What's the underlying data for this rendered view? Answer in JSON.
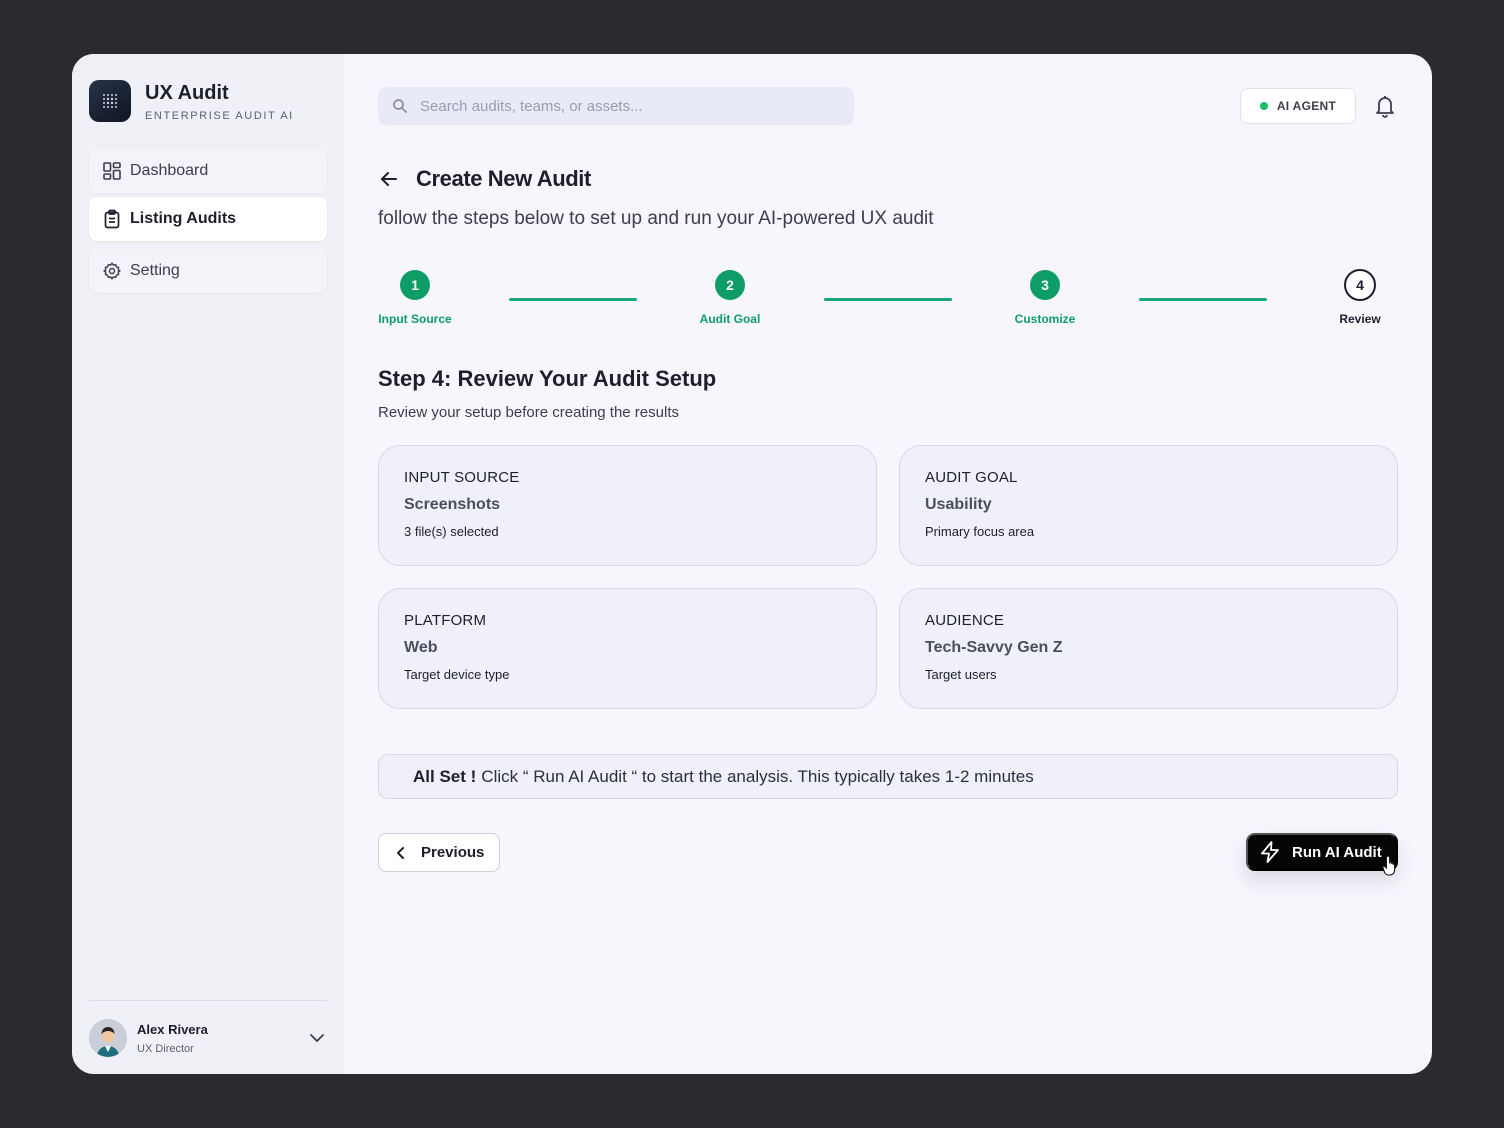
{
  "brand": {
    "name": "UX Audit",
    "subtitle": "ENTERPRISE AUDIT AI"
  },
  "sidebar": {
    "items": [
      {
        "label": "Dashboard",
        "icon": "dashboard-icon",
        "active": false
      },
      {
        "label": "Listing Audits",
        "icon": "clipboard-icon",
        "active": true
      },
      {
        "label": "Setting",
        "icon": "gear-icon",
        "active": false
      }
    ]
  },
  "user": {
    "name": "Alex Rivera",
    "role": "UX Director"
  },
  "header": {
    "search_placeholder": "Search audits, teams, or assets...",
    "agent_label": "AI AGENT"
  },
  "page": {
    "title": "Create New Audit",
    "subtitle": "follow the steps below to set up and run your AI-powered UX audit"
  },
  "steps": [
    {
      "number": "1",
      "label": "Input Source",
      "state": "done"
    },
    {
      "number": "2",
      "label": "Audit Goal",
      "state": "done"
    },
    {
      "number": "3",
      "label": "Customize",
      "state": "done"
    },
    {
      "number": "4",
      "label": "Review",
      "state": "current"
    }
  ],
  "review": {
    "title": "Step 4: Review Your Audit Setup",
    "subtitle": "Review your setup before creating the results",
    "cards": [
      {
        "label": "INPUT SOURCE",
        "value": "Screenshots",
        "desc": "3 file(s) selected"
      },
      {
        "label": "AUDIT GOAL",
        "value": "Usability",
        "desc": "Primary focus area"
      },
      {
        "label": "PLATFORM",
        "value": "Web",
        "desc": "Target device type"
      },
      {
        "label": "AUDIENCE",
        "value": "Tech-Savvy Gen Z",
        "desc": "Target users"
      }
    ]
  },
  "notice": {
    "strong": "All Set !",
    "text": "Click “ Run AI Audit “ to start the analysis. This typically takes 1-2 minutes"
  },
  "actions": {
    "previous_label": "Previous",
    "run_label": "Run AI Audit"
  },
  "colors": {
    "accent_green": "#0f9d67",
    "status_dot": "#1bbf6a",
    "primary_button": "#050505"
  }
}
